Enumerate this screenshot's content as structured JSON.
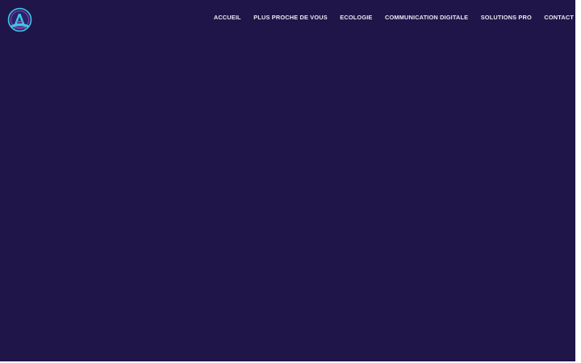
{
  "brand": {
    "logo_icon": "brand-logo-icon",
    "colors": {
      "background": "#1f1548",
      "logo_primary": "#3ec6e8",
      "logo_accent": "#c13fb7",
      "nav_text": "#e9e8f3"
    }
  },
  "nav": {
    "items": [
      {
        "label": "ACCUEIL"
      },
      {
        "label": "PLUS PROCHE DE VOUS"
      },
      {
        "label": "ECOLOGIE"
      },
      {
        "label": "COMMUNICATION DIGITALE"
      },
      {
        "label": "SOLUTIONS PRO"
      },
      {
        "label": "CONTACT"
      }
    ]
  }
}
